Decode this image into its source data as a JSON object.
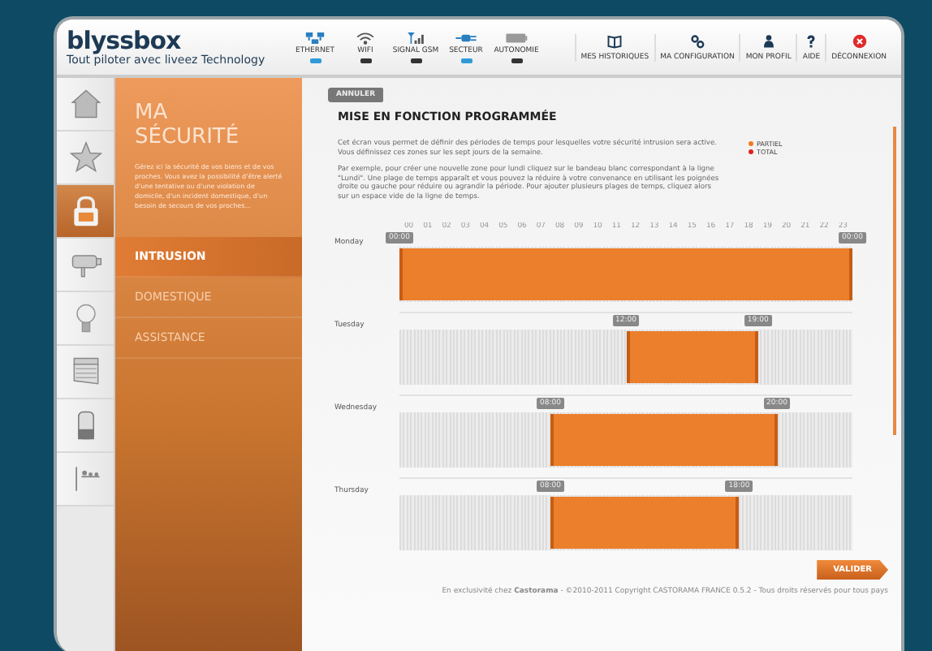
{
  "header": {
    "logo": "blyssbox",
    "tagline": "Tout piloter avec liveez Technology",
    "status": [
      {
        "kind": "ethernet",
        "label": "ETHERNET",
        "active": true
      },
      {
        "kind": "wifi",
        "label": "WIFI",
        "active": false
      },
      {
        "kind": "gsm",
        "label": "SIGNAL GSM",
        "active": false
      },
      {
        "kind": "plug",
        "label": "SECTEUR",
        "active": true
      },
      {
        "kind": "battery",
        "label": "AUTONOMIE",
        "active": false
      }
    ],
    "nav": [
      {
        "kind": "book",
        "label": "MES HISTORIQUES"
      },
      {
        "kind": "gears",
        "label": "MA CONFIGURATION"
      },
      {
        "kind": "person",
        "label": "MON PROFIL"
      },
      {
        "kind": "help",
        "label": "AIDE"
      },
      {
        "kind": "logout",
        "label": "DÉCONNEXION"
      }
    ]
  },
  "sidebar": {
    "items": [
      {
        "kind": "house",
        "selected": false
      },
      {
        "kind": "star",
        "selected": false
      },
      {
        "kind": "lock",
        "selected": true
      },
      {
        "kind": "camera",
        "selected": false
      },
      {
        "kind": "bulb",
        "selected": false
      },
      {
        "kind": "shutter",
        "selected": false
      },
      {
        "kind": "canister",
        "selected": false
      },
      {
        "kind": "garden",
        "selected": false
      }
    ]
  },
  "section": {
    "title": "MA SÉCURITÉ",
    "description": "Gérez ici la sécurité de vos biens et de vos proches. Vous avez la possibilité d'être alerté d'une tentative ou d'une violation de domicile, d'un incident domestique, d'un besoin de secours de vos proches...",
    "menu": [
      {
        "label": "INTRUSION",
        "selected": true
      },
      {
        "label": "DOMESTIQUE",
        "selected": false
      },
      {
        "label": "ASSISTANCE",
        "selected": false
      }
    ]
  },
  "main": {
    "cancel_button": "ANNULER",
    "title": "MISE EN FONCTION PROGRAMMÉE",
    "paragraphs": [
      "Cet écran vous permet de définir des périodes de temps pour lesquelles votre sécurité intrusion sera active. Vous définissez ces zones sur les sept jours de la semaine.",
      "Par exemple, pour créer une nouvelle zone pour lundi cliquez sur le bandeau blanc correspondant à la ligne \"Lundi\". Une plage de temps apparaît et vous pouvez la réduire à votre convenance en utilisant les poignées droite ou gauche pour réduire ou agrandir la période. Pour ajouter plusieurs plages de temps, cliquez alors sur un espace vide de la ligne de temps."
    ],
    "legend": [
      {
        "label": "PARTIEL",
        "color": "#f07a22"
      },
      {
        "label": "TOTAL",
        "color": "#e02020"
      }
    ],
    "hours": [
      "00",
      "01",
      "02",
      "03",
      "04",
      "05",
      "06",
      "07",
      "08",
      "09",
      "10",
      "11",
      "12",
      "13",
      "14",
      "15",
      "16",
      "17",
      "18",
      "19",
      "20",
      "21",
      "22",
      "23"
    ],
    "days": [
      {
        "label": "Monday",
        "start": "00:00",
        "end": "00:00"
      },
      {
        "label": "Tuesday",
        "start": "12:00",
        "end": "19:00"
      },
      {
        "label": "Wednesday",
        "start": "08:00",
        "end": "20:00"
      },
      {
        "label": "Thursday",
        "start": "08:00",
        "end": "18:00"
      }
    ],
    "validate_button": "VALIDER",
    "footer": "En exclusivité chez **Castorama** - ©2010-2011 Copyright CASTORAMA FRANCE 0.5.2 - Tous droits réservés pour tous pays"
  }
}
